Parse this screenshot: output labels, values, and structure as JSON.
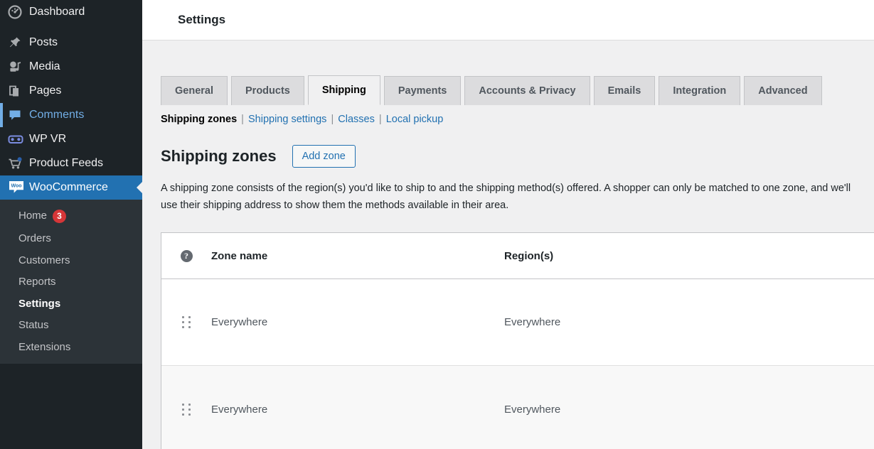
{
  "sidebar": {
    "items": [
      {
        "label": "Dashboard",
        "icon": "dashboard-icon",
        "state": "normal"
      },
      {
        "label": "Posts",
        "icon": "pin-icon",
        "state": "normal"
      },
      {
        "label": "Media",
        "icon": "media-icon",
        "state": "normal"
      },
      {
        "label": "Pages",
        "icon": "pages-icon",
        "state": "normal"
      },
      {
        "label": "Comments",
        "icon": "comment-bubble-icon",
        "state": "hovered"
      },
      {
        "label": "WP VR",
        "icon": "vr-goggles-icon",
        "state": "normal"
      },
      {
        "label": "Product Feeds",
        "icon": "shopping-cart-icon",
        "state": "normal"
      },
      {
        "label": "WooCommerce",
        "icon": "woocommerce-icon",
        "state": "current"
      }
    ],
    "submenu": [
      {
        "label": "Home",
        "badge": "3",
        "active": false
      },
      {
        "label": "Orders",
        "badge": "",
        "active": false
      },
      {
        "label": "Customers",
        "badge": "",
        "active": false
      },
      {
        "label": "Reports",
        "badge": "",
        "active": false
      },
      {
        "label": "Settings",
        "badge": "",
        "active": true
      },
      {
        "label": "Status",
        "badge": "",
        "active": false
      },
      {
        "label": "Extensions",
        "badge": "",
        "active": false
      }
    ]
  },
  "header": {
    "title": "Settings"
  },
  "tabs": [
    {
      "label": "General",
      "active": false
    },
    {
      "label": "Products",
      "active": false
    },
    {
      "label": "Shipping",
      "active": true
    },
    {
      "label": "Payments",
      "active": false
    },
    {
      "label": "Accounts & Privacy",
      "active": false
    },
    {
      "label": "Emails",
      "active": false
    },
    {
      "label": "Integration",
      "active": false
    },
    {
      "label": "Advanced",
      "active": false
    }
  ],
  "subnav": {
    "current": "Shipping zones",
    "links": [
      "Shipping settings",
      "Classes",
      "Local pickup"
    ],
    "separator": "|"
  },
  "zones": {
    "heading": "Shipping zones",
    "add_button": "Add zone",
    "description": "A shipping zone consists of the region(s) you'd like to ship to and the shipping method(s) offered. A shopper can only be matched to one zone, and we'll use their shipping address to show them the methods available in their area.",
    "columns": {
      "help": "?",
      "zone_name": "Zone name",
      "regions": "Region(s)"
    },
    "rows": [
      {
        "name": "Everywhere",
        "region": "Everywhere"
      },
      {
        "name": "Everywhere",
        "region": "Everywhere"
      }
    ]
  },
  "colors": {
    "sidebar_bg": "#1d2327",
    "submenu_bg": "#2c3338",
    "accent_blue": "#2271b1",
    "hover_blue": "#72aee6",
    "badge_red": "#d63638",
    "content_bg": "#f0f0f1",
    "tab_bg": "#dcdcde"
  }
}
